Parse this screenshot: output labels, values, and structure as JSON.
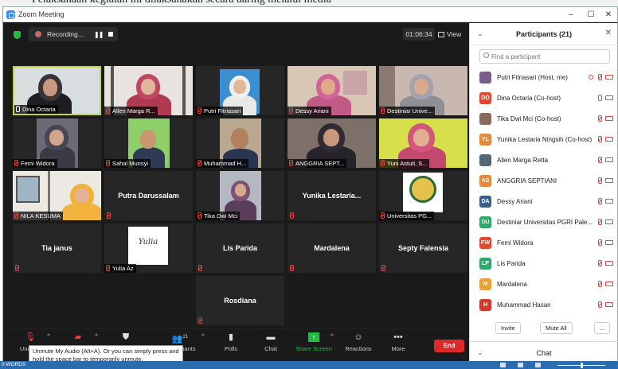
{
  "window": {
    "title": "Zoom Meeting",
    "minimize": "–",
    "maximize": "☐",
    "close": "✕"
  },
  "doc_behind": {
    "text": "Pelaksanaan kegiatan ini dilaksanakan secara daring melalui media"
  },
  "recording": {
    "label": "Recording...",
    "pause": "❚❚"
  },
  "meeting": {
    "timer": "01:06:34",
    "view_label": "View"
  },
  "tiles": [
    {
      "name": "Dina Octaria"
    },
    {
      "name": "Allen Marga R..."
    },
    {
      "name": "Putri Fitriasari"
    },
    {
      "name": "Dessy Ariani"
    },
    {
      "name": "Destiniar Unive..."
    },
    {
      "name": "Femi Widora"
    },
    {
      "name": "Sahal Munsyi"
    },
    {
      "name": "Muhammad H..."
    },
    {
      "name": "ANGGRIA SEPT..."
    },
    {
      "name": "Yuni Astuti, S..."
    },
    {
      "name": "NILA KESUMA"
    },
    {
      "name": "Putra Darussalam"
    },
    {
      "name": "Tika Dwi Mci"
    },
    {
      "name": "Yunika Lestaria..."
    },
    {
      "name": "Universitas PG..."
    },
    {
      "name": "Tia janus"
    },
    {
      "name": "Yulia Az"
    },
    {
      "name": "Lis Parida"
    },
    {
      "name": "Mardalena"
    },
    {
      "name": "Septy Falensia"
    },
    {
      "name": "Rosdiana"
    }
  ],
  "toolbar": {
    "unmute": "Unmute",
    "participants_count": "21",
    "participants_label": "Participants",
    "polls": "Polls",
    "chat": "Chat",
    "share": "Share Screen",
    "reactions": "Reactions",
    "more": "More",
    "end": "End"
  },
  "tooltip": {
    "text": "Unmute My Audio (Alt+A). Or you can simply press and hold the space bar to temporarily unmute."
  },
  "panel": {
    "title": "Participants (21)",
    "search_placeholder": "Find a participant",
    "participants": [
      {
        "name": "Putri Fitriasari (Host, me)",
        "initials": "",
        "color": "#7a5c8a"
      },
      {
        "name": "Dina Octaria (Co-host)",
        "initials": "DO",
        "color": "#e04a2f"
      },
      {
        "name": "Tika Dwi Mci (Co-host)",
        "initials": "",
        "color": "#8a6a5a"
      },
      {
        "name": "Yunika Lestaria Ningsih (Co-host)",
        "initials": "YL",
        "color": "#e8883a"
      },
      {
        "name": "Allen Marga Retta",
        "initials": "",
        "color": "#556677"
      },
      {
        "name": "ANGGRIA SEPTIANI",
        "initials": "AS",
        "color": "#e8883a"
      },
      {
        "name": "Dessy Ariani",
        "initials": "DA",
        "color": "#3a5f8a"
      },
      {
        "name": "Destiniar Universitas PGRI Pale...",
        "initials": "DU",
        "color": "#2fa86b"
      },
      {
        "name": "Femi Widora",
        "initials": "FW",
        "color": "#e04a2f"
      },
      {
        "name": "Lis Parida",
        "initials": "LP",
        "color": "#2fa86b"
      },
      {
        "name": "Mardalena",
        "initials": "M",
        "color": "#e8a23a"
      },
      {
        "name": "Muhammad Hasan",
        "initials": "H",
        "color": "#d23a2a"
      }
    ],
    "invite": "Invite",
    "mute_all": "Mute All",
    "more": "...",
    "chat": "Chat"
  },
  "taskbar": {
    "words": "0 WORDS"
  },
  "colors": {
    "accent": "#2d8cff",
    "end": "#e02828",
    "share": "#22bb44",
    "active_border": "#c5d14a"
  }
}
